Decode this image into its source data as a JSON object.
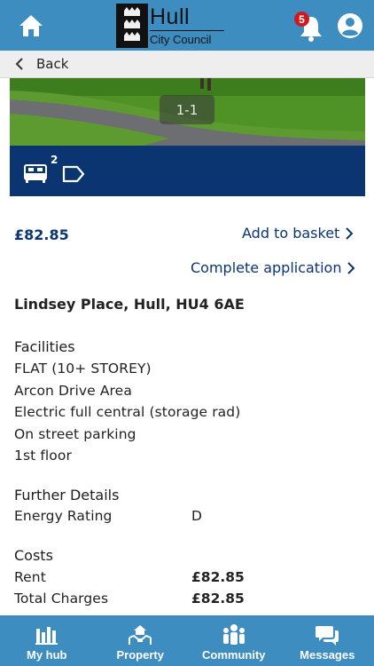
{
  "header": {
    "logo": {
      "line1": "Hull",
      "line2": "City Council"
    },
    "notifications": {
      "count": "5"
    },
    "icons": [
      "home-icon",
      "bell-icon",
      "user-icon"
    ]
  },
  "backbar": {
    "label": "Back"
  },
  "gallery": {
    "pager": "1-1"
  },
  "summary": {
    "bedrooms": "2",
    "icons": [
      "bed-icon",
      "tag-icon"
    ]
  },
  "listing": {
    "price": "£82.85",
    "add_to_basket": "Add to basket",
    "complete_application": "Complete application",
    "address": "Lindsey Place, Hull, HU4 6AE"
  },
  "facilities": {
    "title": "Facilities",
    "items": [
      "FLAT (10+ STOREY)",
      "Arcon Drive Area",
      "Electric full central (storage rad)",
      "On street parking",
      "1st floor"
    ]
  },
  "further_details": {
    "title": "Further Details",
    "rows": [
      {
        "label": "Energy Rating",
        "value": "D"
      }
    ]
  },
  "costs": {
    "title": "Costs",
    "rows": [
      {
        "label": "Rent",
        "value": "£82.85"
      },
      {
        "label": "Total Charges",
        "value": "£82.85"
      }
    ]
  },
  "bottom_nav": {
    "items": [
      {
        "label": "My hub",
        "icon": "hub-icon"
      },
      {
        "label": "Property",
        "icon": "property-icon"
      },
      {
        "label": "Community",
        "icon": "community-icon"
      },
      {
        "label": "Messages",
        "icon": "messages-icon"
      }
    ]
  },
  "colors": {
    "brand_blue": "#3d8dc1",
    "navy": "#0b3570",
    "badge_red": "#d01822"
  }
}
